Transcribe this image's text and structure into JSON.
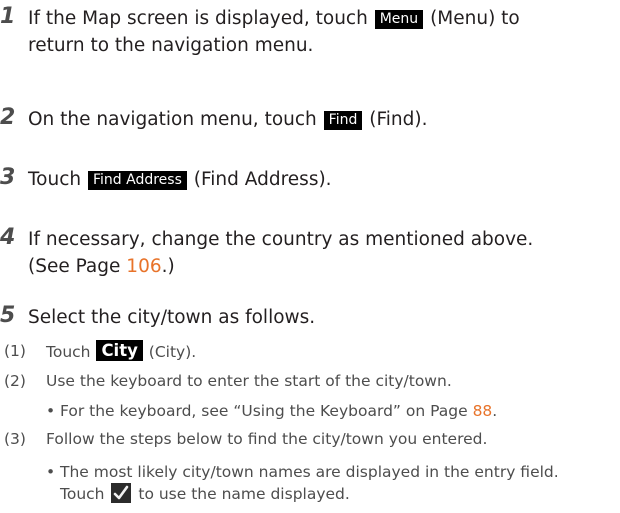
{
  "steps": [
    {
      "num": "1",
      "pre": "If the Map screen is displayed, touch",
      "key": "Menu",
      "post": "(Menu) to",
      "line2": "return to the navigation menu."
    },
    {
      "num": "2",
      "pre": "On the navigation menu, touch",
      "key": "Find",
      "post": "(Find)."
    },
    {
      "num": "3",
      "pre": "Touch",
      "key": "Find Address",
      "post": "(Find Address)."
    },
    {
      "num": "4",
      "line1": "If necessary, change the country as mentioned above.",
      "line2_pre": "(See Page",
      "page": "106",
      "line2_post": ".)"
    },
    {
      "num": "5",
      "line1": "Select the city/town as follows."
    }
  ],
  "substeps": [
    {
      "n": "(1)",
      "pre": "Touch",
      "key": "City",
      "post": "(City)."
    },
    {
      "n": "(2)",
      "text": "Use the keyboard to enter the start of the city/town."
    },
    {
      "n": "(3)",
      "text": "Follow the steps below to find the city/town you entered."
    }
  ],
  "bullets": [
    {
      "dot": "•",
      "pre": "For the keyboard, see “Using the Keyboard” on Page",
      "page": "88",
      "post": "."
    },
    {
      "dot": "•",
      "line1": "The most likely city/town names are displayed in the entry field.",
      "line2_pre": "Touch",
      "line2_post": "to use the name displayed.",
      "icon": "check-icon"
    }
  ],
  "colors": {
    "link": "#e8732a",
    "key_bg": "#000000"
  }
}
